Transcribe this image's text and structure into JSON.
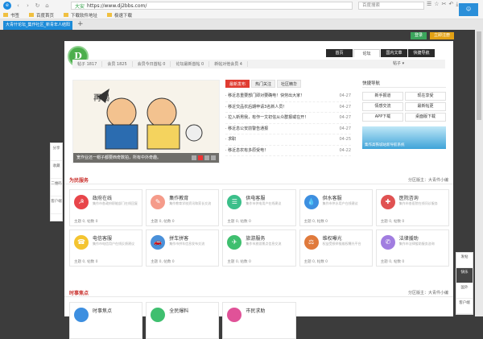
{
  "browser": {
    "url_secure": "大安",
    "url": "https://www.dj2bbs.com/",
    "search_placeholder": "百度搜索",
    "bookmarks": [
      "书签",
      "百度首页",
      "下载软件地址",
      "极速下载"
    ],
    "tab_title": "大青什论坛_集作社区_新青年人结阳",
    "new_tab": "+"
  },
  "header": {
    "login": "登录",
    "register": "立即注册",
    "logo_text": "D",
    "tabs": [
      "首页",
      "论坛",
      "国内文章",
      "快捷导航"
    ]
  },
  "stats": {
    "items": [
      "帖子 1817",
      "会员 1825",
      "会员今日首帖 0",
      "论坛最新首帖 0",
      "新帖对他会员 4"
    ],
    "sort": "帖子 ▾"
  },
  "banner": {
    "caption": "宽作业还一帽子都要西奇数拍，所有中外奇趣。"
  },
  "news": {
    "tabs": [
      "最新发布",
      "热门关注",
      "社区精华"
    ],
    "items": [
      {
        "title": "· 移近息重要部门即对要确电！快劳出大家！",
        "date": "04-27"
      },
      {
        "title": "· 移近交品农后期申请3名新人员！",
        "date": "04-27"
      },
      {
        "title": "· 拉入新男我，有作一文初信从众群报或在开！",
        "date": "04-27"
      },
      {
        "title": "· 移近息公安前警告通报",
        "date": "04-27"
      },
      {
        "title": "· 求职",
        "date": "04-25"
      },
      {
        "title": "· 移近息农有多原受电！",
        "date": "04-22"
      }
    ]
  },
  "quick_nav": {
    "title": "快捷导航",
    "buttons": [
      "新手报道",
      "现在享受",
      "情感交流",
      "最新帖更",
      "APP下载",
      "桌面版下载"
    ],
    "banner_text": "集作高铁城站新导航系统"
  },
  "section1": {
    "title": "为民服务",
    "right": "分区版主：大青件小编",
    "cards": [
      {
        "name": "政府在线",
        "desc": "集作市各政府职能部门在线回复",
        "meta": "主题 0, 帖数 0",
        "color": "#e8454a",
        "icon": "☭"
      },
      {
        "name": "集作教育",
        "desc": "集作教育学校资讯和家长交流",
        "meta": "主题 0, 帖数 0",
        "color": "#f59b8a",
        "icon": "✎"
      },
      {
        "name": "供电客服",
        "desc": "集作市供电用户在线建议",
        "meta": "主题 0, 帖数 0",
        "color": "#3bbf8a",
        "icon": "☰"
      },
      {
        "name": "供水客服",
        "desc": "集作市供水用户在线建议",
        "meta": "主题 0, 帖数 0",
        "color": "#3d8fe0",
        "icon": "💧"
      },
      {
        "name": "医院咨询",
        "desc": "集作市各医院在线问诊服务",
        "meta": "主题 0, 帖数 0",
        "color": "#e05252",
        "icon": "✚"
      },
      {
        "name": "电信客服",
        "desc": "集作市电信用户在线反馈建议",
        "meta": "主题 0, 帖数 0",
        "color": "#f4c430",
        "icon": "☎"
      },
      {
        "name": "拼车拼客",
        "desc": "集作市拼车信息发布交流",
        "meta": "主题 0, 帖数 0",
        "color": "#4a90d9",
        "icon": "🚗"
      },
      {
        "name": "旅游服务",
        "desc": "集作市旅游景点信息交流",
        "meta": "主题 0, 帖数 0",
        "color": "#3fbf6f",
        "icon": "✈"
      },
      {
        "name": "维权曝光",
        "desc": "权益受损举报维权曝光平台",
        "meta": "主题 0, 帖数 0",
        "color": "#e07a3c",
        "icon": "⚖"
      },
      {
        "name": "法律援助",
        "desc": "集作市法律援助服务咨询",
        "meta": "主题 0, 帖数 0",
        "color": "#a17de0",
        "icon": "✆"
      }
    ]
  },
  "section2": {
    "title": "时事焦点",
    "right": "分区版主：大青件小编",
    "cards": [
      {
        "name": "时事焦点",
        "color": "#3d8fe0"
      },
      {
        "name": "全民爆料",
        "color": "#3fbf6f"
      },
      {
        "name": "市民求助",
        "color": "#e05298"
      }
    ]
  },
  "side_left": [
    "分享",
    "收藏",
    "二维码",
    "客户端"
  ],
  "side_right": [
    "发帖",
    "快乐",
    "国外",
    "客户端"
  ]
}
